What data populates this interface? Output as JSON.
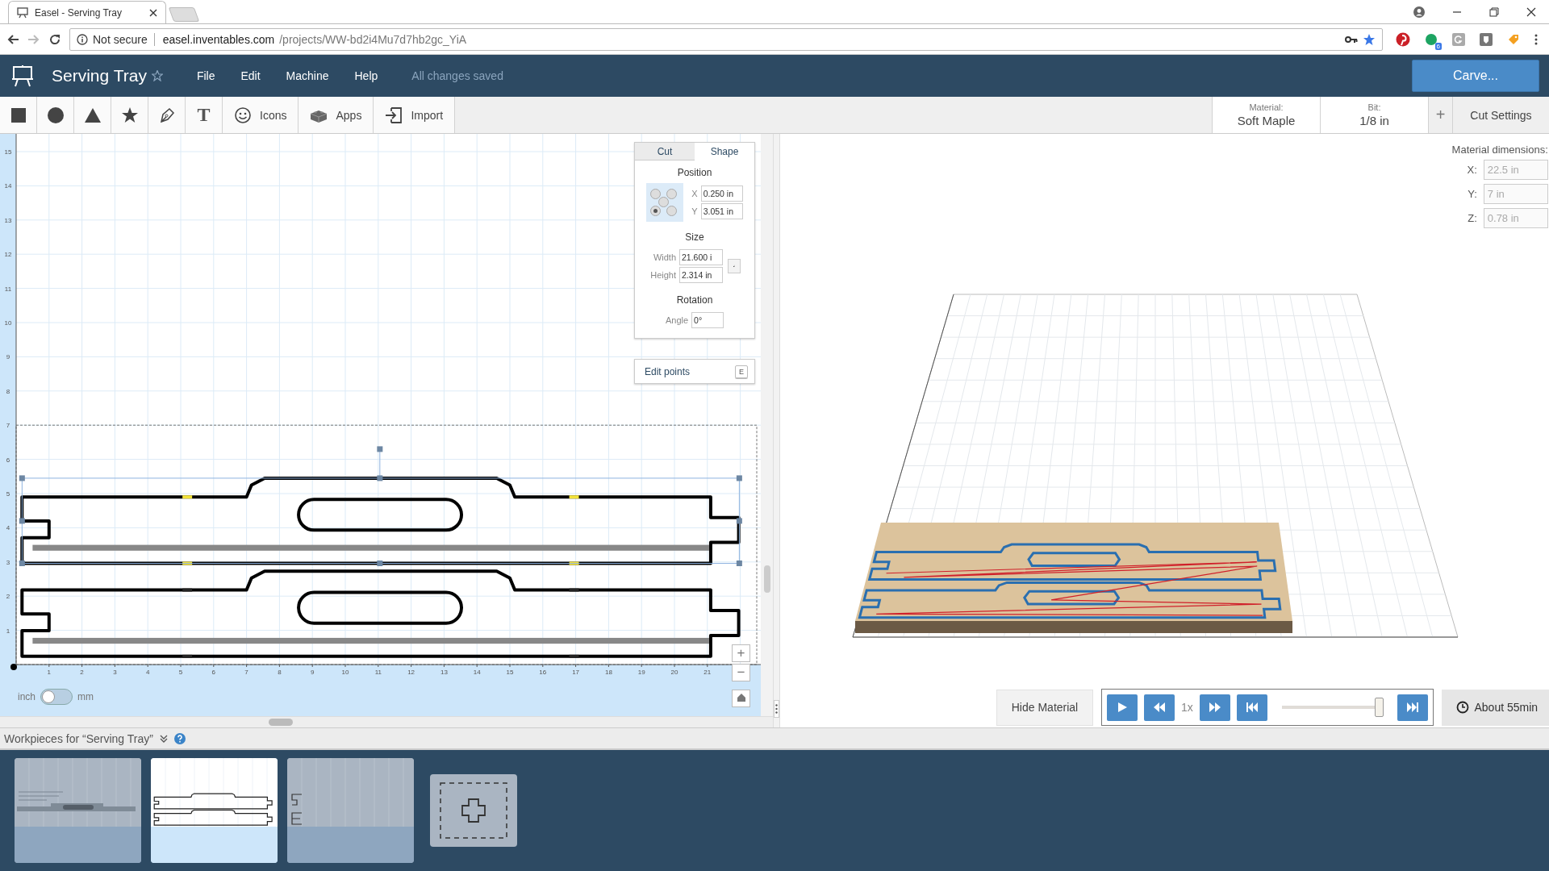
{
  "browser": {
    "tab_title": "Easel - Serving Tray",
    "security": "Not secure",
    "url_host": "easel.inventables.com",
    "url_path": "/projects/WW-bd2i4Mu7d7hb2gc_YiA",
    "extension_badge": "6"
  },
  "app": {
    "project_title": "Serving Tray",
    "starred": false,
    "menu": [
      "File",
      "Edit",
      "Machine",
      "Help"
    ],
    "save_status": "All changes saved",
    "carve_button": "Carve..."
  },
  "toolbar": {
    "tools": [
      {
        "kind": "square"
      },
      {
        "kind": "circle"
      },
      {
        "kind": "triangle"
      },
      {
        "kind": "star"
      },
      {
        "kind": "pen"
      },
      {
        "kind": "text",
        "glyph": "T"
      },
      {
        "kind": "icons",
        "label": "Icons"
      },
      {
        "kind": "apps",
        "label": "Apps"
      },
      {
        "kind": "import",
        "label": "Import"
      }
    ],
    "material": {
      "label": "Material:",
      "value": "Soft Maple"
    },
    "bit": {
      "label": "Bit:",
      "value": "1/8 in"
    },
    "add_button": "+",
    "cut_settings": "Cut Settings"
  },
  "canvas": {
    "x_ruler": [
      "1",
      "2",
      "3",
      "4",
      "5",
      "6",
      "7",
      "8",
      "9",
      "10",
      "11",
      "12",
      "13",
      "14",
      "15",
      "16",
      "17",
      "18",
      "19",
      "20",
      "21"
    ],
    "y_ruler": [
      "15",
      "14",
      "13",
      "12",
      "11",
      "10",
      "9",
      "8",
      "7",
      "6",
      "5",
      "4",
      "3",
      "2",
      "1"
    ],
    "zoom_in": "+",
    "zoom_out": "−"
  },
  "shape_panel": {
    "tabs": [
      {
        "label": "Cut",
        "selected": false
      },
      {
        "label": "Shape",
        "selected": true
      }
    ],
    "position": {
      "heading": "Position",
      "anchors": [
        {
          "selected": false
        },
        {
          "selected": false
        },
        {
          "selected": false
        },
        {
          "selected": true
        },
        {
          "selected": false
        }
      ],
      "x_label": "X",
      "x_value": "0.250 in",
      "y_label": "Y",
      "y_value": "3.051 in"
    },
    "size": {
      "heading": "Size",
      "width_label": "Width",
      "width_value": "21.600 i",
      "height_label": "Height",
      "height_value": "2.314 in",
      "locked": false
    },
    "rotation": {
      "heading": "Rotation",
      "angle_label": "Angle",
      "angle_value": "0°"
    },
    "edit_points": "Edit points",
    "edit_shortcut": "E"
  },
  "units": {
    "left_label": "inch",
    "right_label": "mm",
    "metric": false
  },
  "material_dimensions": {
    "heading": "Material dimensions:",
    "fields": [
      {
        "label": "X:",
        "value": "22.5 in",
        "disabled": true
      },
      {
        "label": "Y:",
        "value": "7 in",
        "disabled": true
      },
      {
        "label": "Z:",
        "value": "0.78 in",
        "disabled": true
      }
    ]
  },
  "preview": {
    "hide_material": "Hide Material",
    "speed": "1x",
    "level": 0.97,
    "estimate": "About 55min"
  },
  "workpieces": {
    "title": "Workpieces for “Serving Tray”",
    "items": [
      {
        "selected": false,
        "kind": "notes"
      },
      {
        "selected": true,
        "kind": "tray"
      },
      {
        "selected": false,
        "kind": "joints"
      }
    ]
  }
}
